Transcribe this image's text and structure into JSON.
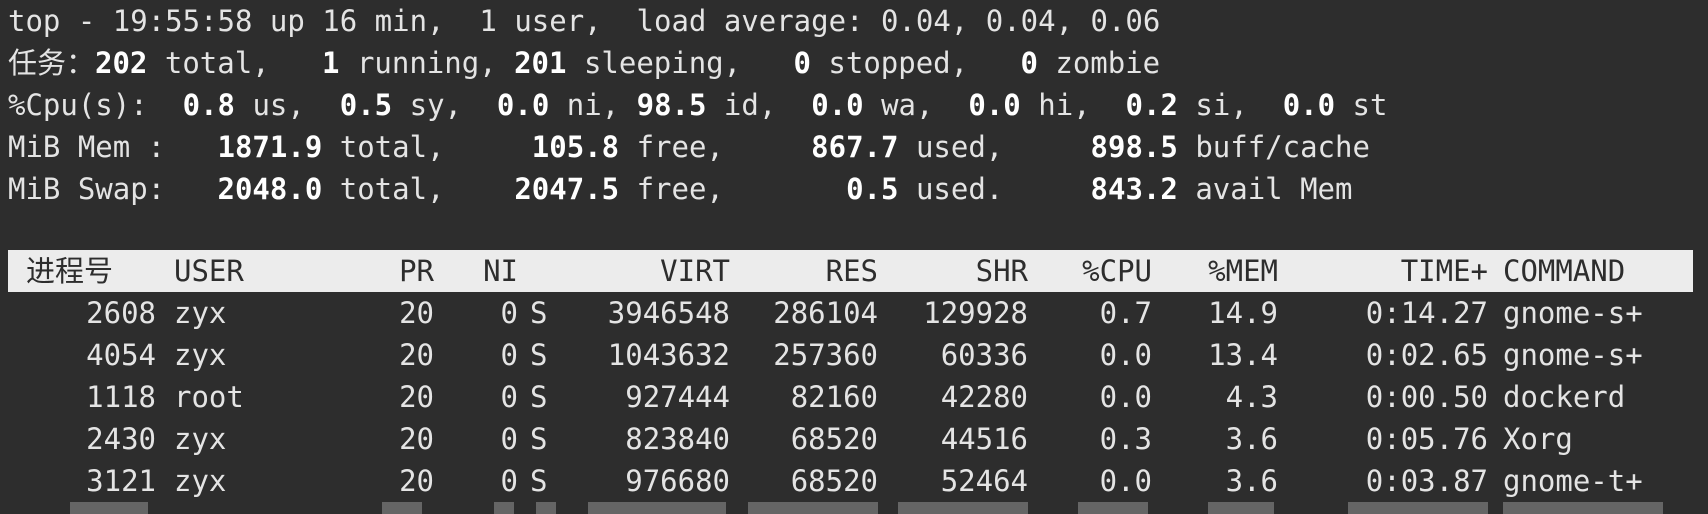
{
  "summary": {
    "line1": "top - 19:55:58 up 16 min,  1 user,  load average: 0.04, 0.04, 0.06",
    "tasks": {
      "label": "任务：",
      "total": "202",
      "total_label": " total,   ",
      "running": "1",
      "running_label": " running, ",
      "sleeping": "201",
      "sleeping_label": " sleeping,   ",
      "stopped": "0",
      "stopped_label": " stopped,   ",
      "zombie": "0",
      "zombie_label": " zombie"
    },
    "cpu": {
      "label": "%Cpu(s):  ",
      "us": "0.8",
      "us_label": " us,  ",
      "sy": "0.5",
      "sy_label": " sy,  ",
      "ni": "0.0",
      "ni_label": " ni, ",
      "id": "98.5",
      "id_label": " id,  ",
      "wa": "0.0",
      "wa_label": " wa,  ",
      "hi": "0.0",
      "hi_label": " hi,  ",
      "si": "0.2",
      "si_label": " si,  ",
      "st": "0.0",
      "st_label": " st"
    },
    "mem": {
      "label": "MiB Mem :   ",
      "total": "1871.9",
      "total_label": " total,     ",
      "free": "105.8",
      "free_label": " free,     ",
      "used": "867.7",
      "used_label": " used,     ",
      "cache": "898.5",
      "cache_label": " buff/cache"
    },
    "swap": {
      "label": "MiB Swap:   ",
      "total": "2048.0",
      "total_label": " total,    ",
      "free": "2047.5",
      "free_label": " free,       ",
      "used": "0.5",
      "used_label": " used.     ",
      "avail": "843.2",
      "avail_label": " avail Mem"
    }
  },
  "columns": {
    "pid": "进程号",
    "user": "USER",
    "pr": "PR",
    "ni": "NI",
    "virt": "VIRT",
    "res": "RES",
    "shr": "SHR",
    "cpu": "%CPU",
    "mem": "%MEM",
    "time": "TIME+",
    "command": "COMMAND"
  },
  "processes": [
    {
      "pid": "2608",
      "user": "zyx",
      "pr": "20",
      "ni": "0",
      "s": "S",
      "virt": "3946548",
      "res": "286104",
      "shr": "129928",
      "cpu": "0.7",
      "mem": "14.9",
      "time": "0:14.27",
      "command": "gnome-s+"
    },
    {
      "pid": "4054",
      "user": "zyx",
      "pr": "20",
      "ni": "0",
      "s": "S",
      "virt": "1043632",
      "res": "257360",
      "shr": "60336",
      "cpu": "0.0",
      "mem": "13.4",
      "time": "0:02.65",
      "command": "gnome-s+"
    },
    {
      "pid": "1118",
      "user": "root",
      "pr": "20",
      "ni": "0",
      "s": "S",
      "virt": "927444",
      "res": "82160",
      "shr": "42280",
      "cpu": "0.0",
      "mem": "4.3",
      "time": "0:00.50",
      "command": "dockerd"
    },
    {
      "pid": "2430",
      "user": "zyx",
      "pr": "20",
      "ni": "0",
      "s": "S",
      "virt": "823840",
      "res": "68520",
      "shr": "44516",
      "cpu": "0.3",
      "mem": "3.6",
      "time": "0:05.76",
      "command": "Xorg"
    },
    {
      "pid": "3121",
      "user": "zyx",
      "pr": "20",
      "ni": "0",
      "s": "S",
      "virt": "976680",
      "res": "68520",
      "shr": "52464",
      "cpu": "0.0",
      "mem": "3.6",
      "time": "0:03.87",
      "command": "gnome-t+"
    }
  ]
}
